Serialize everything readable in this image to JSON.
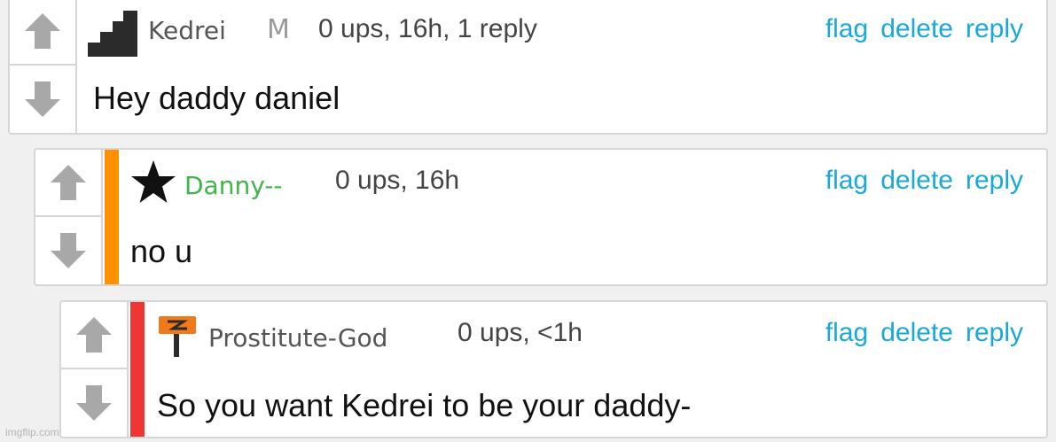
{
  "comments": [
    {
      "username": "Kedrei",
      "user_tag": "M",
      "username_color": "#555555",
      "meta": "0 ups, 16h, 1 reply",
      "body": "Hey daddy daniel",
      "actions": {
        "flag": "flag",
        "delete": "delete",
        "reply": "reply"
      },
      "badge_icon": "stairs-icon"
    },
    {
      "username": "Danny--",
      "username_color": "#3fb54a",
      "stripe_color": "#ff9000",
      "meta": "0 ups, 16h",
      "body": "no u",
      "actions": {
        "flag": "flag",
        "delete": "delete",
        "reply": "reply"
      },
      "badge_icon": "star-icon"
    },
    {
      "username": "Prostitute-God",
      "username_color": "#555555",
      "stripe_color": "#f03535",
      "meta": "0 ups, <1h",
      "body": "So you want Kedrei to be your daddy-",
      "actions": {
        "flag": "flag",
        "delete": "delete",
        "reply": "reply"
      },
      "badge_icon": "signpost-icon"
    }
  ],
  "watermark": "imgflip.com",
  "colors": {
    "link": "#18a9d8",
    "arrow": "#a8a8a8",
    "border": "#d6d6d6"
  }
}
